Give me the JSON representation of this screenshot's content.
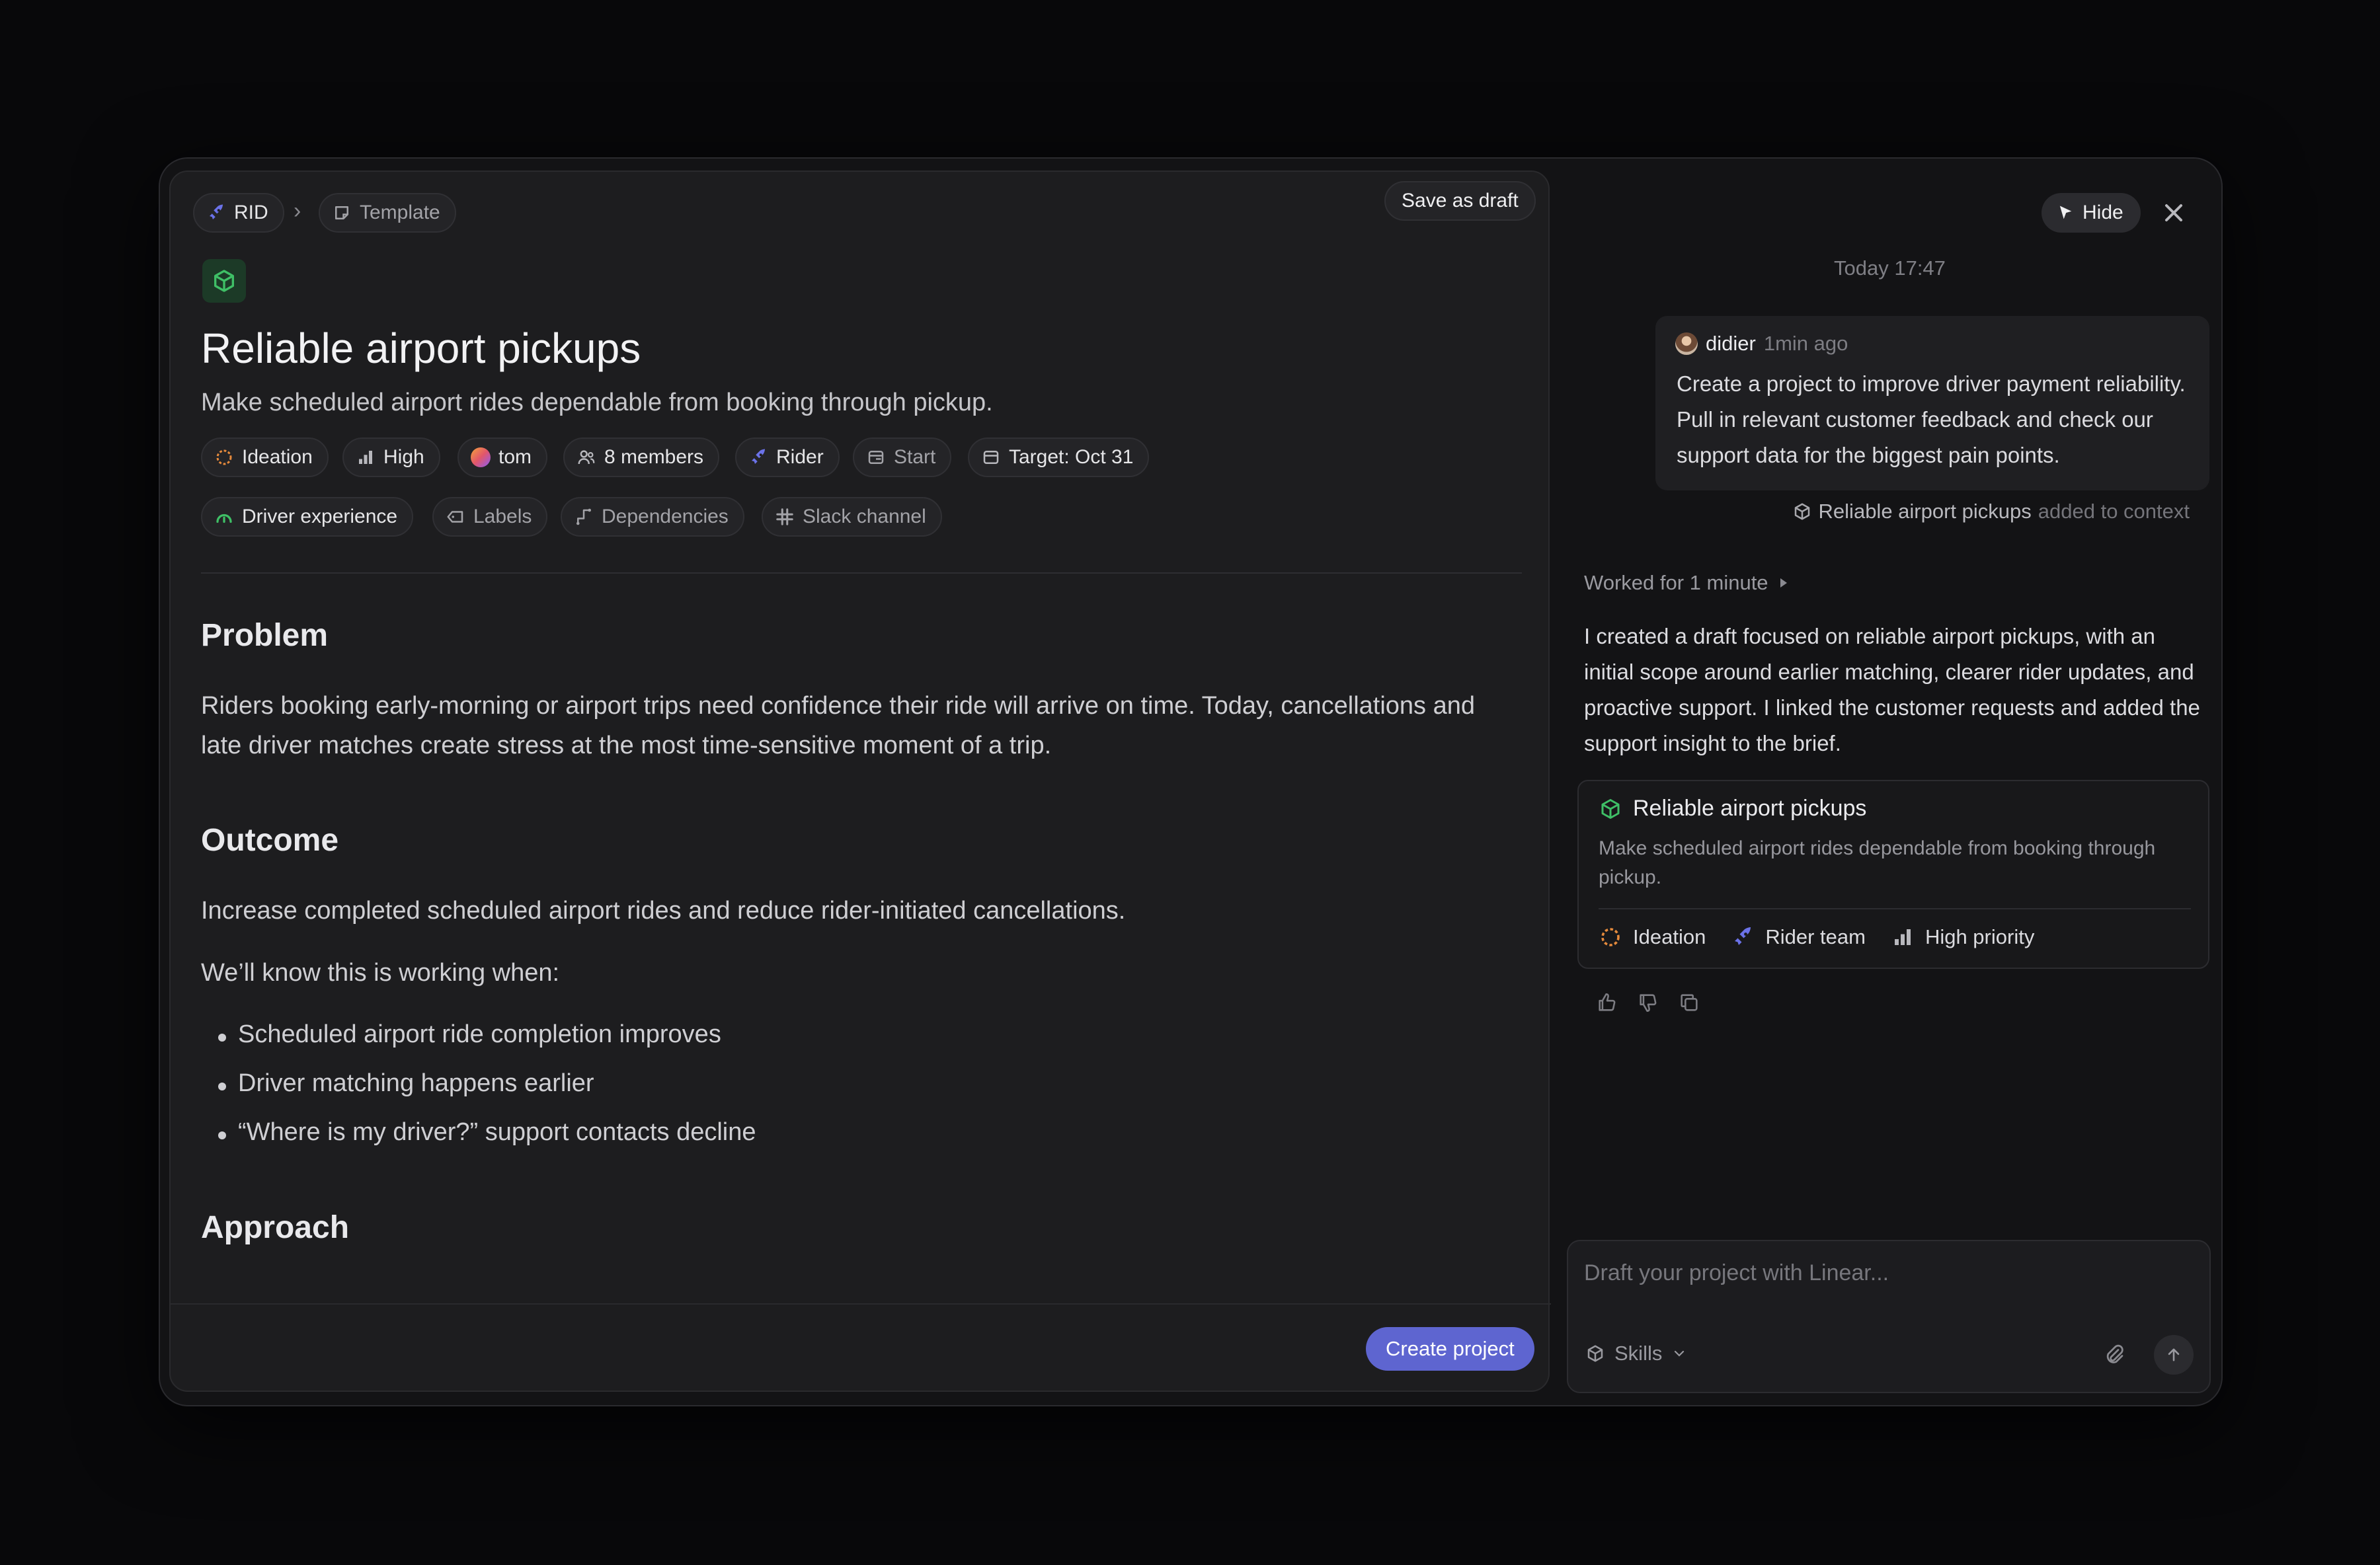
{
  "breadcrumb": {
    "team": "RID",
    "template": "Template"
  },
  "toolbar": {
    "save_draft": "Save as draft"
  },
  "project": {
    "title": "Reliable airport pickups",
    "summary": "Make scheduled airport rides dependable from booking through pickup.",
    "properties": {
      "status": "Ideation",
      "priority": "High",
      "lead": "tom",
      "members": "8 members",
      "team": "Rider",
      "start": "Start",
      "target": "Target: Oct 31",
      "initiative": "Driver experience",
      "labels": "Labels",
      "dependencies": "Dependencies",
      "slack": "Slack channel"
    }
  },
  "doc": {
    "problem_heading": "Problem",
    "problem_text": "Riders booking early-morning or airport trips need confidence their ride will arrive on time. Today, cancellations and late driver matches create stress at the most time-sensitive moment of a trip.",
    "outcome_heading": "Outcome",
    "outcome_text": "Increase completed scheduled airport rides and reduce rider-initiated cancellations.",
    "working_when": "We’ll know this is working when:",
    "bullets": [
      "Scheduled airport ride completion improves",
      "Driver matching happens earlier",
      "“Where is my driver?” support contacts decline"
    ],
    "approach_heading": "Approach"
  },
  "footer": {
    "create_button": "Create project"
  },
  "panel": {
    "hide_label": "Hide",
    "timestamp": "Today 17:47",
    "message": {
      "author": "didier",
      "time": "1min ago",
      "text": "Create a project to improve driver payment reliability. Pull in relevant customer feedback and check our support data for the biggest pain points."
    },
    "context": {
      "name": "Reliable airport pickups",
      "suffix": "added to context"
    },
    "worked": "Worked for 1 minute",
    "reply": "I created a draft focused on reliable airport pickups, with an initial scope around earlier matching, clearer rider updates, and proactive support. I linked the customer requests and added the support insight to the brief.",
    "card": {
      "title": "Reliable airport pickups",
      "desc": "Make scheduled airport rides dependable from booking through pickup.",
      "status": "Ideation",
      "team": "Rider team",
      "priority": "High priority"
    },
    "composer": {
      "placeholder": "Draft your project with Linear...",
      "skills": "Skills"
    }
  },
  "colors": {
    "accent": "#5e65d0",
    "ideation": "#e58a3c",
    "team_rocket": "#6b72e8",
    "project_green": "#3fbf66"
  }
}
